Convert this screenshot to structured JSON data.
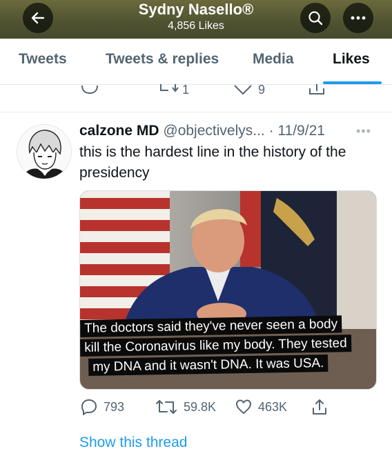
{
  "header": {
    "title": "Sydny Nasello®",
    "likes": "4,856 Likes"
  },
  "tabs": [
    "Tweets",
    "Tweets & replies",
    "Media",
    "Likes"
  ],
  "active_tab": "Likes",
  "prev_tweet": {
    "retweets": "1",
    "likes": "9"
  },
  "tweet": {
    "name": "calzone MD",
    "handle": "@objectivelys...",
    "date": "· 11/9/21",
    "text": "this is the hardest line in the history of the presidency",
    "caption_lines": [
      "The doctors said they've never seen a body",
      "kill the Coronavirus like my body. They tested",
      "my DNA and it wasn't DNA. It was USA."
    ],
    "replies": "793",
    "retweets": "59.8K",
    "likes": "463K",
    "show_thread": "Show this thread"
  },
  "colors": {
    "accent": "#1d9bf0",
    "header_bg": "#4f5231",
    "muted_text": "#536471"
  },
  "icons": [
    "back-arrow-icon",
    "search-icon",
    "more-icon",
    "reply-icon",
    "retweet-icon",
    "like-icon",
    "share-icon"
  ]
}
